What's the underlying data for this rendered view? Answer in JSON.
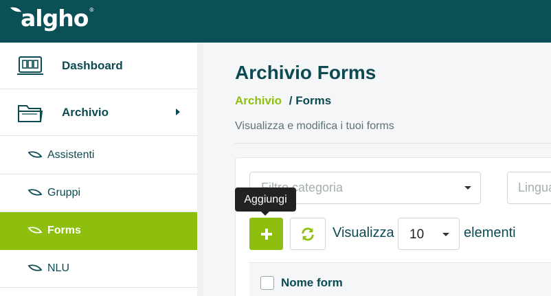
{
  "header": {
    "logo_text": "algho",
    "logo_reg": "®"
  },
  "sidebar": {
    "main_items": [
      {
        "label": "Dashboard",
        "icon": "dashboard-icon"
      },
      {
        "label": "Archivio",
        "icon": "folder-icon",
        "expanded": true
      }
    ],
    "sub_items": [
      {
        "label": "Assistenti",
        "icon": "leaf-icon"
      },
      {
        "label": "Gruppi",
        "icon": "leaf-icon"
      },
      {
        "label": "Forms",
        "icon": "leaf-icon",
        "active": true
      },
      {
        "label": "NLU",
        "icon": "leaf-icon"
      }
    ]
  },
  "main": {
    "title": "Archivio Forms",
    "breadcrumb": {
      "link": "Archivio",
      "separator": "/",
      "current": "Forms"
    },
    "subtitle": "Visualizza e modifica i tuoi forms",
    "filters": {
      "category_placeholder": "Filtro categoria",
      "language_placeholder": "Lingua"
    },
    "toolbar": {
      "add_tooltip": "Aggiungi",
      "show_label": "Visualizza",
      "page_size": "10",
      "elements_label": "elementi"
    },
    "table": {
      "columns": [
        "Nome form"
      ]
    }
  },
  "colors": {
    "brand_dark": "#0b4f57",
    "accent_green": "#8ebf0e",
    "text": "#0b4a52"
  }
}
